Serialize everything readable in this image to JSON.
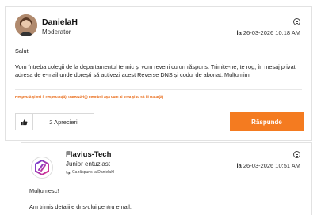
{
  "post1": {
    "author": "DanielaH",
    "role": "Moderator",
    "date_prefix": "la",
    "date": "26-03-2026 10:18 AM",
    "greeting": "Salut!",
    "body": "Vom întreba colegii de la departamentul tehnic și vom reveni cu un răspuns. Trimite-ne, te rog, în mesaj privat adresa de e-mail unde dorești să activezi acest Reverse DNS și codul de abonat. Mulțumim.",
    "notice": "Respectă și vei fi respectat(ă), tratează-i(i) membrii așa cum ai vrea și tu să fii tratat(ă)",
    "likes_label": "2 Aprecieri",
    "reply_label": "Răspunde"
  },
  "post2": {
    "author": "Flavius-Tech",
    "role": "Junior entuziast",
    "reply_to": "Ca răspuns la DanielaH",
    "date_prefix": "la",
    "date": "26-03-2026 10:51 AM",
    "line1": "Mulțumesc!",
    "line2": "Am trimis detaliile dns-ului pentru email."
  },
  "colors": {
    "accent": "#f47b20",
    "notice": "#e8650f",
    "avatar_gradient": [
      "#6b3fd4",
      "#e0338c"
    ]
  },
  "icons": [
    "options-icon",
    "like-thumb-icon",
    "reply-arrow-icon",
    "user-avatar"
  ]
}
